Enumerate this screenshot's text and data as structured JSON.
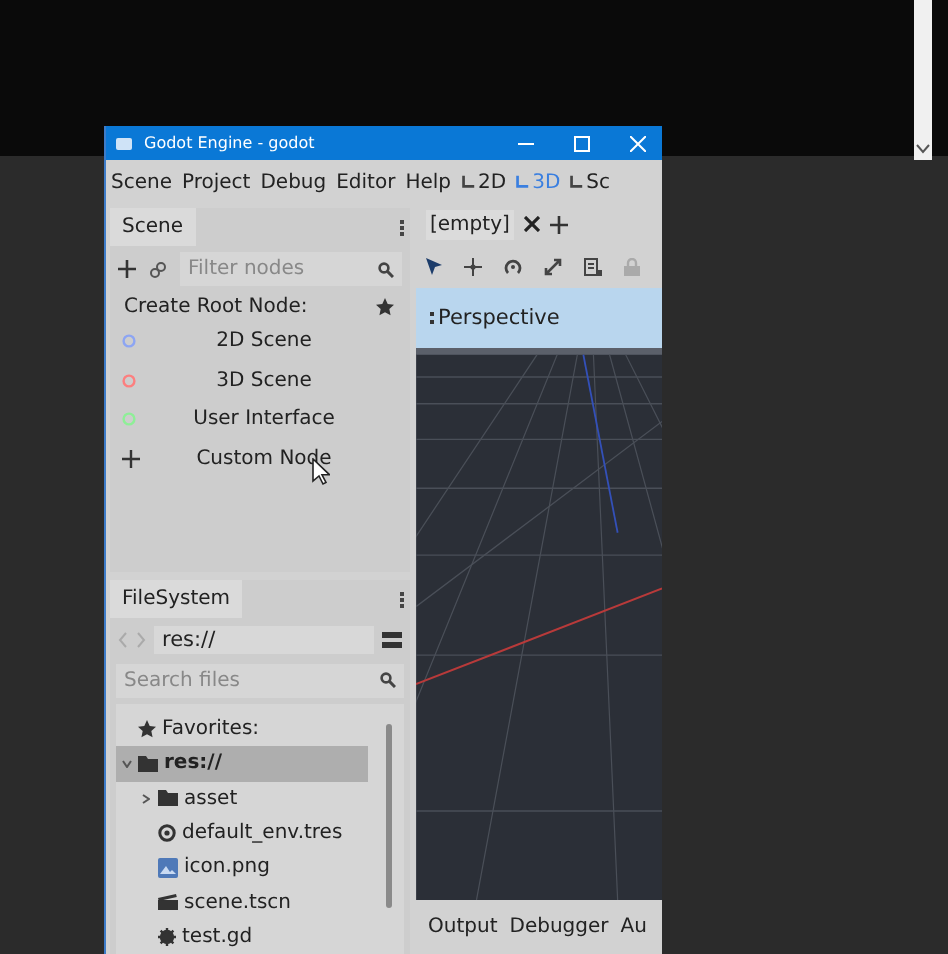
{
  "window": {
    "title": "Godot Engine - godot"
  },
  "menu": [
    "Scene",
    "Project",
    "Debug",
    "Editor",
    "Help"
  ],
  "workspaces": [
    {
      "label": "2D",
      "selected": false
    },
    {
      "label": "3D",
      "selected": true
    },
    {
      "label": "Sc",
      "selected": false
    }
  ],
  "scene_dock": {
    "tab": "Scene",
    "filter": {
      "placeholder": "Filter nodes"
    },
    "create_label": "Create Root Node:",
    "options": [
      {
        "kind": "circle",
        "label": "2D Scene",
        "color": "#8da5f3"
      },
      {
        "kind": "circle",
        "label": "3D Scene",
        "color": "#fc7f7f"
      },
      {
        "kind": "circle",
        "label": "User Interface",
        "color": "#8eef97"
      },
      {
        "kind": "plus",
        "label": "Custom Node"
      }
    ]
  },
  "filesystem": {
    "tab": "FileSystem",
    "path": "res://",
    "search": {
      "placeholder": "Search files"
    },
    "tree": [
      {
        "kind": "favorites",
        "label": "Favorites:",
        "selected": false
      },
      {
        "kind": "folder",
        "label": "res://",
        "expanded": true,
        "selected": true,
        "children": [
          {
            "kind": "folder",
            "label": "asset",
            "expanded": false,
            "selected": false
          },
          {
            "kind": "env",
            "label": "default_env.tres",
            "selected": false
          },
          {
            "kind": "image",
            "label": "icon.png",
            "selected": false
          },
          {
            "kind": "scene",
            "label": "scene.tscn",
            "selected": false
          },
          {
            "kind": "script",
            "label": "test.gd",
            "selected": false
          }
        ]
      }
    ]
  },
  "editor": {
    "tab": "[empty]",
    "viewport_label": "Perspective"
  },
  "bottom_tabs": [
    "Output",
    "Debugger",
    "Au"
  ]
}
